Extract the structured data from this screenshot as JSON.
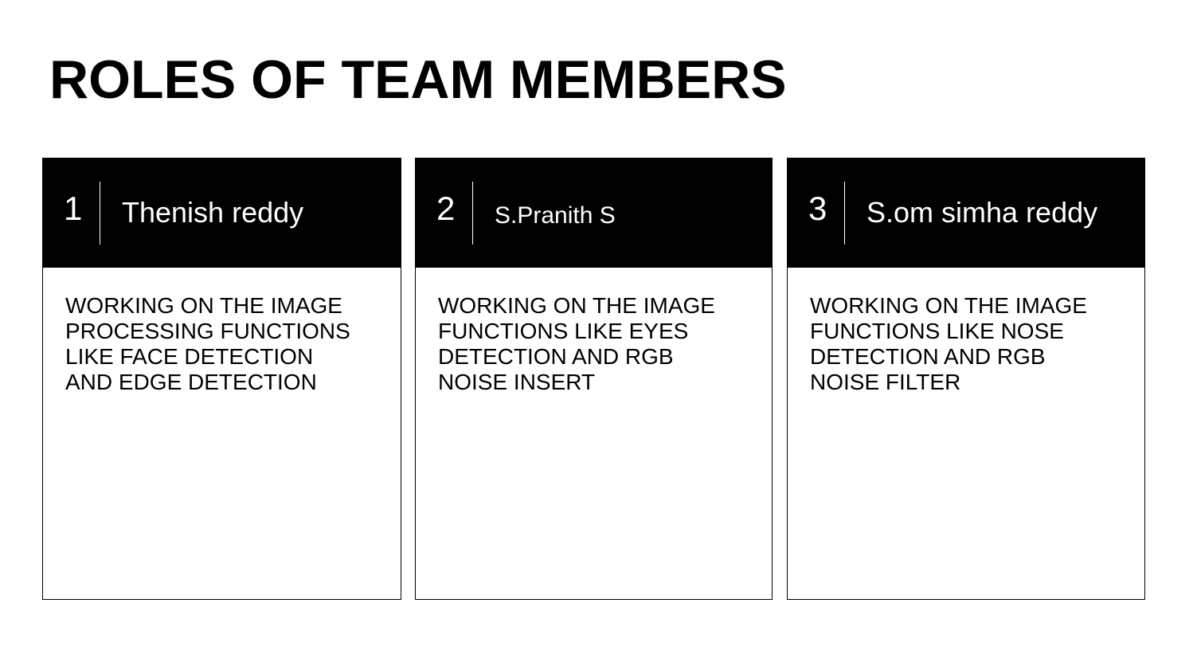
{
  "title": "ROLES OF TEAM MEMBERS",
  "members": [
    {
      "number": "1",
      "name": "Thenish reddy",
      "role": "WORKING ON THE IMAGE\nPROCESSING FUNCTIONS\nLIKE FACE  DETECTION\nAND EDGE DETECTION"
    },
    {
      "number": "2",
      "name": "S.Pranith S",
      "role": "WORKING ON THE IMAGE\nFUNCTIONS LIKE EYES\nDETECTION AND RGB\nNOISE INSERT"
    },
    {
      "number": "3",
      "name": "S.om simha reddy",
      "role": "WORKING ON THE IMAGE\nFUNCTIONS LIKE NOSE\nDETECTION  AND RGB\nNOISE FILTER"
    }
  ]
}
